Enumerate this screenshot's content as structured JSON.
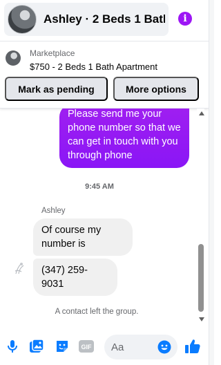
{
  "header": {
    "title": "Ashley · 2 Beds 1 Bath…",
    "info_icon_label": "i"
  },
  "listing": {
    "source": "Marketplace",
    "price_title": "$750 - 2 Beds 1 Bath Apartment",
    "mark_pending_label": "Mark as pending",
    "more_options_label": "More options"
  },
  "conversation": {
    "outgoing_message": "Please send me your phone  number so that we can get in touch with you through phone",
    "timestamp": "9:45 AM",
    "sender_name": "Ashley",
    "incoming_messages": [
      "Of course my number is",
      "(347) 259-9031"
    ],
    "system_message": "A contact left the group."
  },
  "composer": {
    "placeholder": "Aa",
    "gif_label": "GIF"
  },
  "colors": {
    "accent": "#9d16f5",
    "brand_blue": "#0a7cff",
    "incoming_bubble": "#f0f0f0",
    "button_gray": "#e4e6eb"
  },
  "icons": [
    "info-icon",
    "microphone-icon",
    "photo-icon",
    "sticker-icon",
    "gif-icon",
    "emoji-icon",
    "thumbs-up-icon"
  ]
}
